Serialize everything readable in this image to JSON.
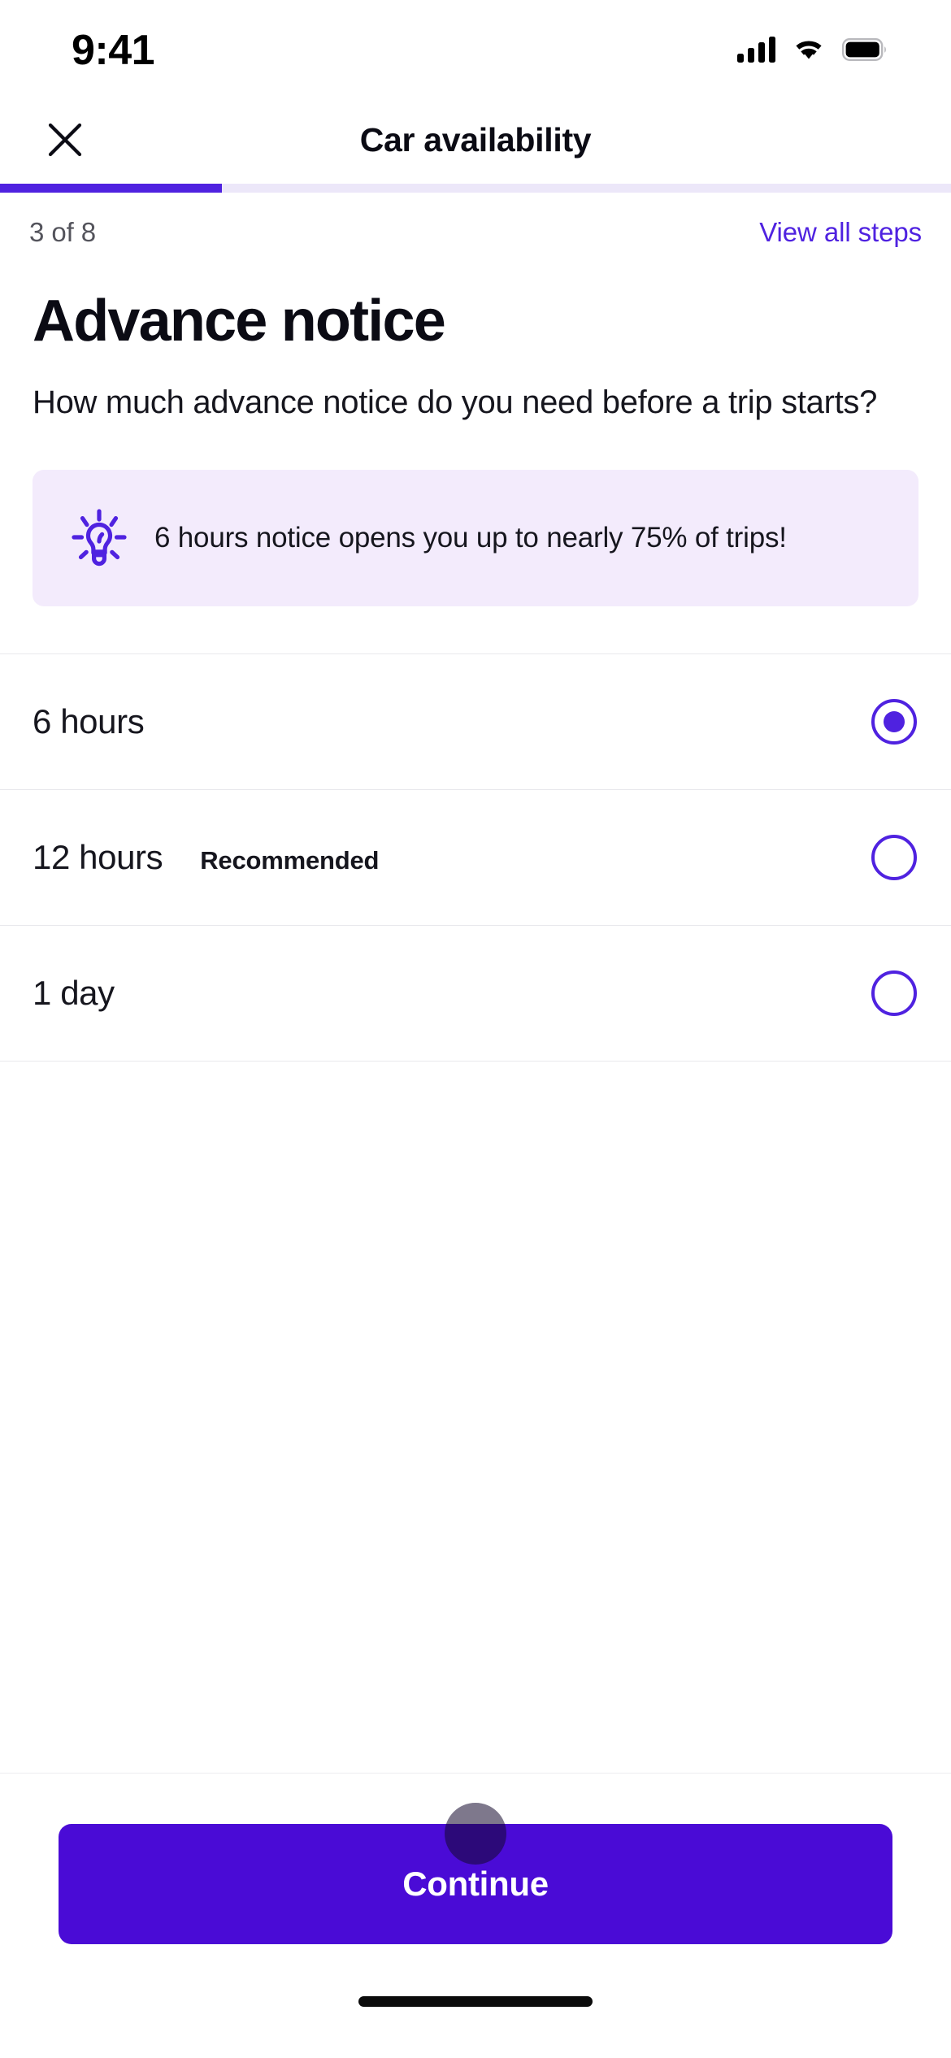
{
  "status_bar": {
    "time": "9:41",
    "cellular_icon": "signal-bars-icon",
    "wifi_icon": "wifi-icon",
    "battery_icon": "battery-full-icon"
  },
  "nav": {
    "close_icon": "close-x-icon",
    "title": "Car availability"
  },
  "progress": {
    "percent": 23.3,
    "current_step": 3,
    "total_steps": 8,
    "step_label": "3 of 8",
    "view_all_label": "View all steps",
    "fill_color": "#4f22e0",
    "track_color": "#ece7f9"
  },
  "main": {
    "title": "Advance notice",
    "subtitle": "How much advance notice do you need before a trip starts?",
    "tip": {
      "icon": "lightbulb-icon",
      "text": "6 hours notice opens you up to nearly 75% of trips!",
      "background_color": "#f3ebfc",
      "icon_color": "#4f22e0"
    },
    "options": [
      {
        "label": "6 hours",
        "badge": "",
        "selected": true
      },
      {
        "label": "12 hours",
        "badge": "Recommended",
        "selected": false
      },
      {
        "label": "1 day",
        "badge": "",
        "selected": false
      }
    ]
  },
  "footer": {
    "continue_label": "Continue",
    "button_color": "#4a0bd6",
    "tap_indicator": "tap-indicator-dot"
  },
  "colors": {
    "accent": "#4f22e0",
    "cta": "#4a0bd6",
    "text": "#16161e",
    "muted": "#54545c"
  }
}
